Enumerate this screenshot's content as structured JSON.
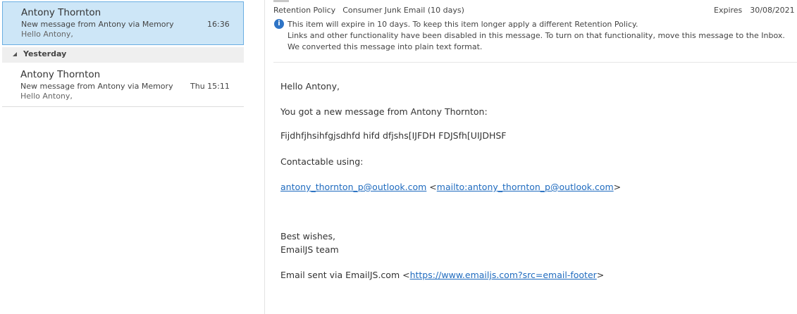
{
  "message_list": {
    "selected_message": {
      "sender": "Antony Thornton",
      "subject": "New message from Antony via Memory ...",
      "time": "16:36",
      "preview": "Hello Antony,"
    },
    "group_header": "Yesterday",
    "messages": [
      {
        "sender": "Antony Thornton",
        "subject": "New message from Antony via Memory ...",
        "time": "Thu 15:11",
        "preview": "Hello Antony,"
      }
    ]
  },
  "reading_pane": {
    "retention_label": "Retention Policy",
    "retention_value": "Consumer Junk Email (10 days)",
    "expires_label": "Expires",
    "expires_value": "30/08/2021",
    "info_icon": "info-icon",
    "info_lines": [
      "This item will expire in 10 days. To keep this item longer apply a different Retention Policy.",
      "Links and other functionality have been disabled in this message. To turn on that functionality, move this message to the Inbox.",
      "We converted this message into plain text format."
    ],
    "body": {
      "greeting": "Hello Antony,",
      "intro": "You got a new message from Antony Thornton:",
      "message_text": "Fijdhfjhsihfgjsdhfd hifd dfjshs[IJFDH FDJSfh[UIJDHSF",
      "contact_label": "Contactable using:",
      "email_link": "antony_thornton_p@outlook.com",
      "mailto_open": " <",
      "mailto_link": "mailto:antony_thornton_p@outlook.com",
      "mailto_close": ">",
      "signoff_line1": "Best wishes,",
      "signoff_line2": "EmailJS team",
      "footer_text": "Email sent via EmailJS.com <",
      "footer_link": "https://www.emailjs.com?src=email-footer",
      "footer_close": ">"
    }
  },
  "colors": {
    "selected_bg": "#cde6f7",
    "selected_border": "#6aaee2",
    "link": "#1f6bbf",
    "info_icon": "#2e74c6",
    "group_header_bg": "#efefef"
  }
}
